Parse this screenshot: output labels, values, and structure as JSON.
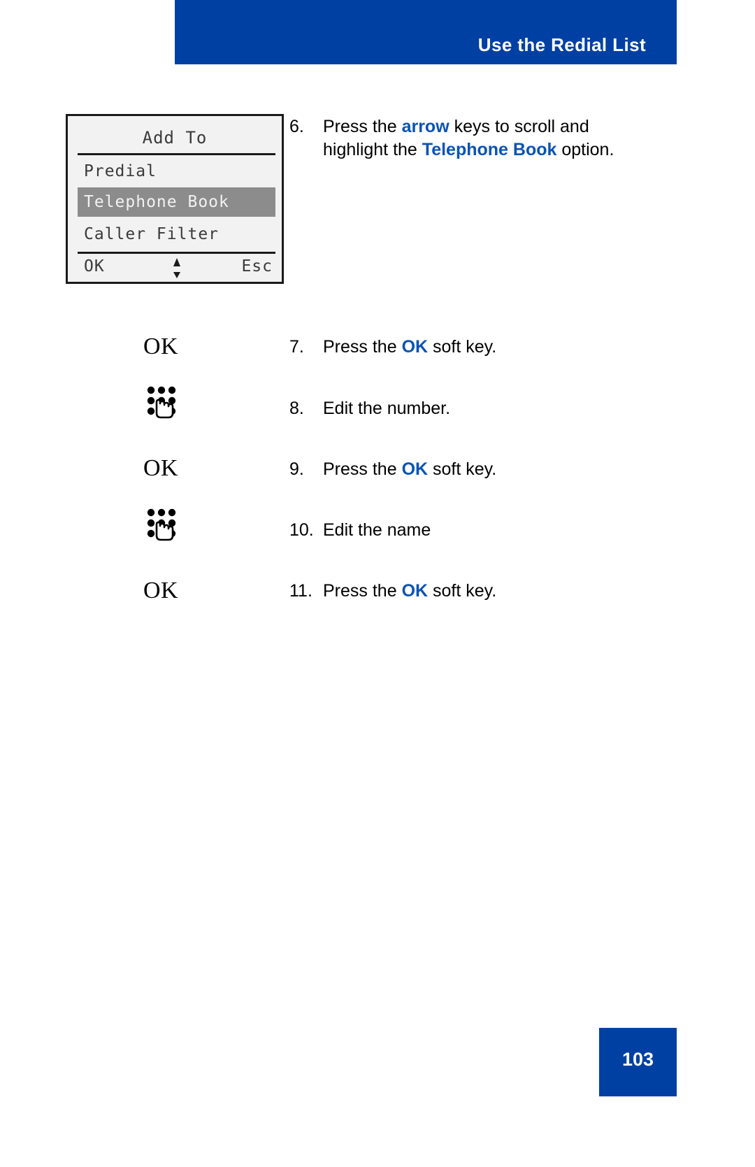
{
  "header": {
    "title": "Use the Redial List",
    "bar_color": "#0040a3"
  },
  "lcd": {
    "title": "Add To",
    "menu_items": [
      {
        "label": "Predial",
        "selected": false
      },
      {
        "label": "Telephone Book",
        "selected": true
      },
      {
        "label": "Caller Filter",
        "selected": false
      }
    ],
    "soft_keys": {
      "left": "OK",
      "right": "Esc",
      "scroll_icon": "up-down-arrow-icon"
    },
    "highlight_color": "#8c8c8c"
  },
  "steps": [
    {
      "number": "6.",
      "icon": null,
      "text_parts": [
        {
          "t": "Press the ",
          "style": "normal"
        },
        {
          "t": "arrow",
          "style": "blue-bold"
        },
        {
          "t": " keys to scroll and highlight the ",
          "style": "normal"
        },
        {
          "t": "Telephone Book",
          "style": "blue-bold"
        },
        {
          "t": " option.",
          "style": "normal"
        }
      ],
      "plain": "Press the arrow keys to scroll and highlight the Telephone Book option."
    },
    {
      "number": "7.",
      "icon": "ok-soft-key-icon",
      "icon_label": "OK",
      "text_parts": [
        {
          "t": "Press the ",
          "style": "normal"
        },
        {
          "t": "OK",
          "style": "blue-bold"
        },
        {
          "t": " soft key.",
          "style": "normal"
        }
      ],
      "plain": "Press the OK soft key."
    },
    {
      "number": "8.",
      "icon": "dialpad-keypad-icon",
      "icon_label": "",
      "text_parts": [
        {
          "t": "Edit the number.",
          "style": "normal"
        }
      ],
      "plain": "Edit the number."
    },
    {
      "number": "9.",
      "icon": "ok-soft-key-icon",
      "icon_label": "OK",
      "text_parts": [
        {
          "t": "Press the ",
          "style": "normal"
        },
        {
          "t": "OK",
          "style": "blue-bold"
        },
        {
          "t": " soft key.",
          "style": "normal"
        }
      ],
      "plain": "Press the OK soft key."
    },
    {
      "number": "10.",
      "icon": "dialpad-keypad-icon",
      "icon_label": "",
      "text_parts": [
        {
          "t": "Edit the name",
          "style": "normal"
        }
      ],
      "plain": "Edit the name"
    },
    {
      "number": "11.",
      "icon": "ok-soft-key-icon",
      "icon_label": "OK",
      "text_parts": [
        {
          "t": "Press the ",
          "style": "normal"
        },
        {
          "t": "OK",
          "style": "blue-bold"
        },
        {
          "t": " soft key.",
          "style": "normal"
        }
      ],
      "plain": "Press the OK soft key."
    }
  ],
  "footer": {
    "page_number": "103"
  },
  "colors": {
    "brand_blue": "#0040a3",
    "text_blue": "#0a53b5",
    "body_text": "#000000",
    "lcd_background": "#f2f2f2",
    "lcd_text": "#3a3a3a"
  }
}
